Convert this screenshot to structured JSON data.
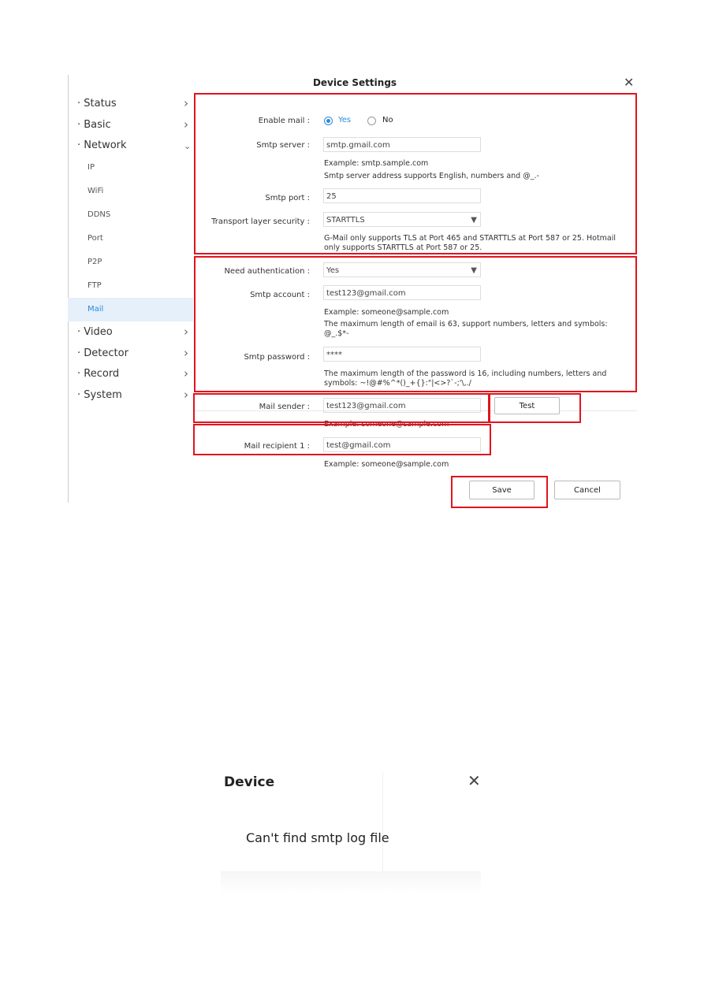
{
  "dialog": {
    "title": "Device Settings",
    "close_icon": "close-icon"
  },
  "sidebar": {
    "items": [
      {
        "label": "Status",
        "type": "main",
        "chevron": "right"
      },
      {
        "label": "Basic",
        "type": "main",
        "chevron": "right"
      },
      {
        "label": "Network",
        "type": "main",
        "chevron": "down"
      },
      {
        "label": "IP",
        "type": "sub"
      },
      {
        "label": "WiFi",
        "type": "sub"
      },
      {
        "label": "DDNS",
        "type": "sub"
      },
      {
        "label": "Port",
        "type": "sub"
      },
      {
        "label": "P2P",
        "type": "sub"
      },
      {
        "label": "FTP",
        "type": "sub"
      },
      {
        "label": "Mail",
        "type": "sub",
        "selected": true
      },
      {
        "label": "Video",
        "type": "main",
        "chevron": "right"
      },
      {
        "label": "Detector",
        "type": "main",
        "chevron": "right"
      },
      {
        "label": "Record",
        "type": "main",
        "chevron": "right"
      },
      {
        "label": "System",
        "type": "main",
        "chevron": "right"
      }
    ]
  },
  "form": {
    "enable_mail": {
      "label": "Enable mail :",
      "yes": "Yes",
      "no": "No",
      "selected": "Yes"
    },
    "smtp_server": {
      "label": "Smtp server :",
      "value": "smtp.gmail.com",
      "note1": "Example: smtp.sample.com",
      "note2": "Smtp server address supports English, numbers and @_.-"
    },
    "smtp_port": {
      "label": "Smtp port :",
      "value": "25"
    },
    "tls": {
      "label": "Transport layer security :",
      "value": "STARTTLS",
      "note": "G-Mail only supports TLS at Port 465 and STARTTLS at Port 587 or 25. Hotmail only supports STARTTLS at Port 587 or 25."
    },
    "need_auth": {
      "label": "Need authentication :",
      "value": "Yes"
    },
    "smtp_account": {
      "label": "Smtp account :",
      "value": "test123@gmail.com",
      "note1": "Example: someone@sample.com",
      "note2": "The maximum length of email is 63, support numbers, letters and symbols: @_.$*-"
    },
    "smtp_password": {
      "label": "Smtp password :",
      "value": "****",
      "note": "The maximum length of the password is 16, including numbers, letters and symbols: ~!@#%^*()_+{}:\"|<>?`-;'\\,./"
    },
    "mail_sender": {
      "label": "Mail sender :",
      "value": "test123@gmail.com",
      "note": "Example: someone@sample.com",
      "test": "Test"
    },
    "mail_recipient": {
      "label": "Mail recipient 1 :",
      "value": "test@gmail.com",
      "note": "Example: someone@sample.com"
    },
    "save": "Save",
    "cancel": "Cancel"
  },
  "popup": {
    "title": "Device",
    "message": "Can't find smtp log file"
  },
  "highlight_color": "#e0141e",
  "accent": "#2a8ad8"
}
